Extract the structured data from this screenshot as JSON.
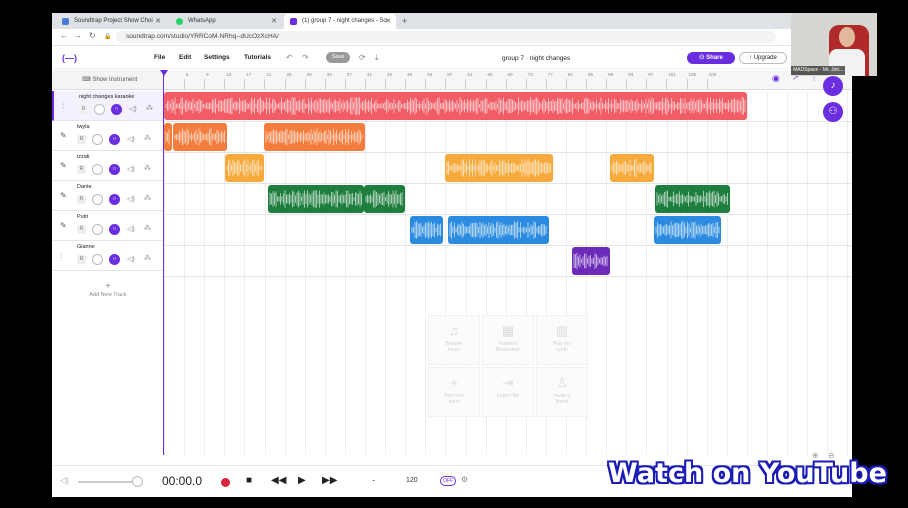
{
  "browser": {
    "tabs": [
      {
        "label": "Soundtrap Project Show Choi",
        "icon_color": "#4a7bd8"
      },
      {
        "label": "WhatsApp",
        "icon_color": "#25d366"
      },
      {
        "label": "(1) group 7 - night changes - So",
        "icon_color": "#6a2ee0"
      }
    ],
    "url": "soundtrap.com/studio/YRRCoM-NRhq--dUcOzXcHA/"
  },
  "app": {
    "logo": "(—)",
    "menu": [
      "File",
      "Edit",
      "Settings",
      "Tutorials"
    ],
    "save_label": "Save",
    "project_title": "group 7 · night changes",
    "share_label": "Share",
    "upgrade_label": "Upgrade",
    "show_instrument": "Show Instrument",
    "add_new_track": "Add New Track"
  },
  "colors": {
    "accent": "#6a2ee0",
    "red": "#f25c64",
    "orange": "#f47c3c",
    "amber": "#f7a93b",
    "green": "#1e7e3e",
    "blue": "#2a8be0",
    "purple": "#6b2ab8"
  },
  "ruler_ticks": [
    "5",
    "9",
    "13",
    "17",
    "21",
    "25",
    "29",
    "33",
    "37",
    "41",
    "45",
    "49",
    "53",
    "57",
    "61",
    "65",
    "69",
    "73",
    "77",
    "81",
    "85",
    "89",
    "93",
    "97",
    "101",
    "105",
    "109"
  ],
  "tracks": [
    {
      "name": "night changes karaoke",
      "icon": "waveform",
      "selected": true,
      "rec": "R",
      "clips": [
        {
          "start": 0.0,
          "end": 0.848,
          "color": "#f25c64"
        }
      ]
    },
    {
      "name": "twyla",
      "icon": "mic",
      "selected": false,
      "rec": "R",
      "clips": [
        {
          "start": 0.0,
          "end": 0.012,
          "color": "#f47c3c"
        },
        {
          "start": 0.013,
          "end": 0.091,
          "color": "#f47c3c"
        },
        {
          "start": 0.145,
          "end": 0.292,
          "color": "#f47c3c"
        }
      ]
    },
    {
      "name": "izzati",
      "icon": "mic",
      "selected": false,
      "rec": "R",
      "clips": [
        {
          "start": 0.088,
          "end": 0.145,
          "color": "#f7a93b"
        },
        {
          "start": 0.408,
          "end": 0.565,
          "color": "#f7a93b"
        },
        {
          "start": 0.648,
          "end": 0.712,
          "color": "#f7a93b"
        }
      ]
    },
    {
      "name": "Dante",
      "icon": "mic",
      "selected": false,
      "rec": "R",
      "clips": [
        {
          "start": 0.151,
          "end": 0.29,
          "color": "#1e7e3e"
        },
        {
          "start": 0.291,
          "end": 0.35,
          "color": "#1e7e3e"
        },
        {
          "start": 0.713,
          "end": 0.822,
          "color": "#1e7e3e"
        }
      ]
    },
    {
      "name": "Putri",
      "icon": "mic",
      "selected": false,
      "rec": "R",
      "clips": [
        {
          "start": 0.357,
          "end": 0.405,
          "color": "#2a8be0"
        },
        {
          "start": 0.413,
          "end": 0.56,
          "color": "#2a8be0"
        },
        {
          "start": 0.712,
          "end": 0.81,
          "color": "#2a8be0"
        }
      ]
    },
    {
      "name": "Gianne",
      "icon": "waveform",
      "selected": false,
      "rec": "R",
      "clips": [
        {
          "start": 0.593,
          "end": 0.648,
          "color": "#6b2ab8"
        }
      ]
    }
  ],
  "quick_actions": [
    {
      "label1": "Browse",
      "label2": "loops",
      "icon": "♫"
    },
    {
      "label1": "Patterns",
      "label2": "Beatmaker",
      "icon": "▦"
    },
    {
      "label1": "Play the",
      "label2": "synth",
      "icon": "▥"
    },
    {
      "label1": "Add new",
      "label2": "track",
      "icon": "+"
    },
    {
      "label1": "Import file",
      "label2": "",
      "icon": "⇥"
    },
    {
      "label1": "Invite a",
      "label2": "friend",
      "icon": "♙"
    }
  ],
  "transport": {
    "time": "00:00.0",
    "key": "-",
    "tempo": "120",
    "metronome": "OFF"
  },
  "webcam_label": "MADSpace - Mr. Joh...",
  "overlay_text": "Watch on YouTube"
}
